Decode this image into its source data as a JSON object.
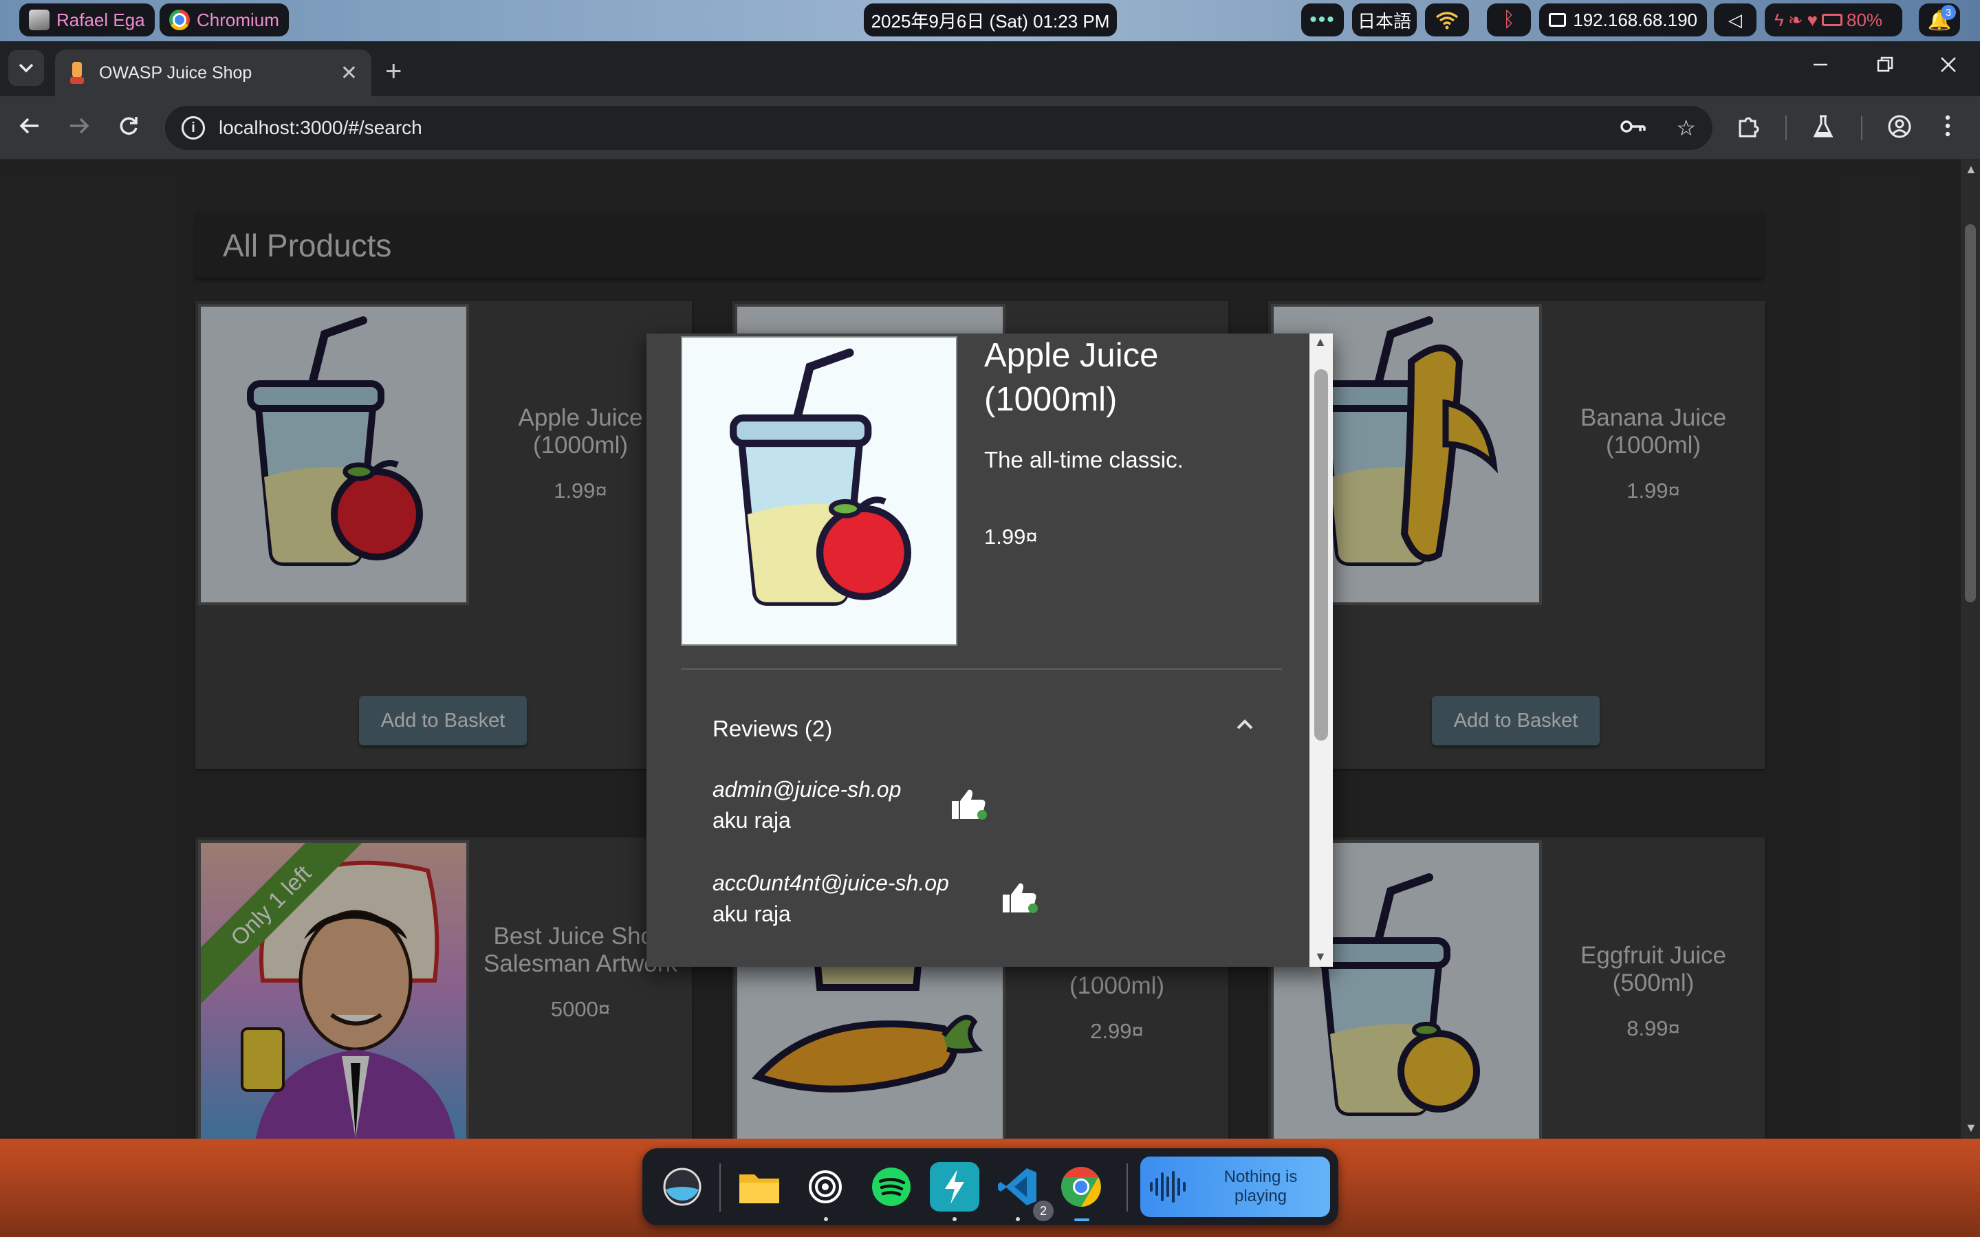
{
  "os": {
    "user_name": "Rafael Ega",
    "active_app": "Chromium",
    "datetime": "2025年9月6日 (Sat) 01:23 PM",
    "ime": "日本語",
    "ip_address": "192.168.68.190",
    "battery": "80%",
    "notification_count": "3"
  },
  "browser": {
    "tab_title": "OWASP Juice Shop",
    "url": "localhost:3000/#/search"
  },
  "page": {
    "heading": "All Products",
    "products": [
      {
        "name": "Apple Juice (1000ml)",
        "price": "1.99¤",
        "button": "Add to Basket"
      },
      {
        "name": "Banana Juice (1000ml)",
        "price": "1.99¤",
        "button": "Add to Basket"
      },
      {
        "name": "Best Juice Shop Salesman Artwork",
        "price": "5000¤",
        "ribbon": "Only 1 left"
      },
      {
        "name": "(1000ml)",
        "price": "2.99¤"
      },
      {
        "name": "Eggfruit Juice (500ml)",
        "price": "8.99¤"
      }
    ]
  },
  "dialog": {
    "title": "Apple Juice (1000ml)",
    "description": "The all-time classic.",
    "price": "1.99¤",
    "reviews_header": "Reviews (2)",
    "reviews": [
      {
        "author": "admin@juice-sh.op",
        "message": "aku raja"
      },
      {
        "author": "acc0unt4nt@juice-sh.op",
        "message": "aku raja"
      }
    ]
  },
  "dock": {
    "media_status": "Nothing is playing",
    "vscode_badge": "2"
  },
  "colors": {
    "accent_button": "#546e7a",
    "ribbon_green": "#5a9a34",
    "page_bg": "#303030",
    "card_bg": "#424242"
  }
}
